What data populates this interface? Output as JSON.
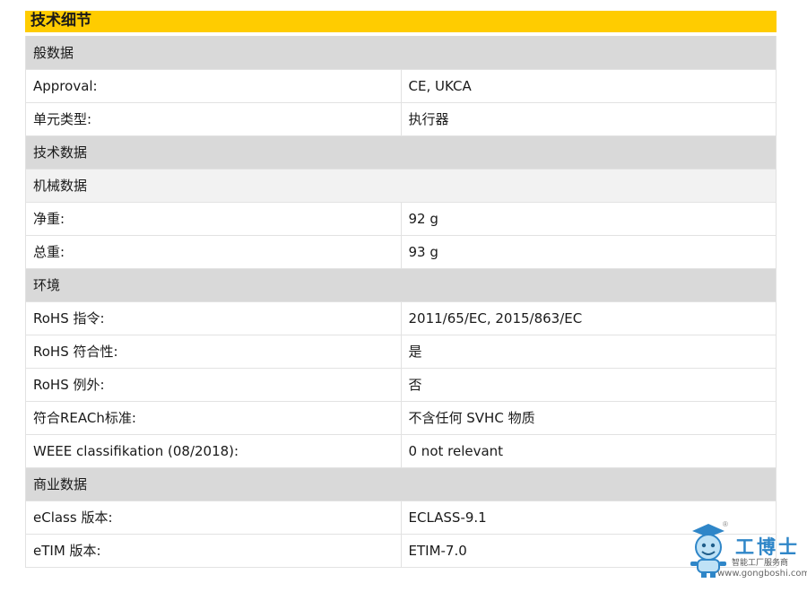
{
  "title": "技术细节",
  "rows": [
    {
      "type": "section",
      "label": "般数据"
    },
    {
      "type": "row",
      "key": "Approval:",
      "value": "CE, UKCA"
    },
    {
      "type": "row",
      "key": "单元类型:",
      "value": "执行器"
    },
    {
      "type": "section",
      "label": "技术数据"
    },
    {
      "type": "subsection",
      "label": "机械数据"
    },
    {
      "type": "row",
      "key": "净重:",
      "value": "92 g"
    },
    {
      "type": "row",
      "key": "总重:",
      "value": "93 g"
    },
    {
      "type": "section",
      "label": "环境"
    },
    {
      "type": "row",
      "key": "RoHS 指令:",
      "value": "2011/65/EC, 2015/863/EC"
    },
    {
      "type": "row",
      "key": "RoHS 符合性:",
      "value": "是"
    },
    {
      "type": "row",
      "key": "RoHS 例外:",
      "value": "否"
    },
    {
      "type": "row",
      "key": "符合REACh标准:",
      "value": "不含任何 SVHC 物质"
    },
    {
      "type": "row",
      "key": "WEEE classifikation (08/2018):",
      "value": "0 not relevant"
    },
    {
      "type": "section",
      "label": "商业数据"
    },
    {
      "type": "row",
      "key": "eClass 版本:",
      "value": "ECLASS-9.1"
    },
    {
      "type": "row",
      "key": "eTIM 版本:",
      "value": "ETIM-7.0"
    }
  ],
  "watermark": {
    "name": "工博士",
    "subtitle": "智能工厂服务商",
    "url": "www.gongboshi.com",
    "reg": "®",
    "accent": "#2f86c8"
  },
  "colors": {
    "title_bar": "#ffcc00",
    "section_bg": "#d9d9d9",
    "subsection_bg": "#f2f2f2"
  }
}
